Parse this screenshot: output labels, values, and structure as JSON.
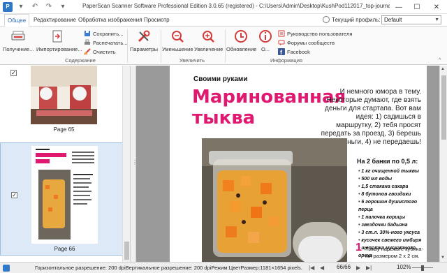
{
  "window": {
    "title": "PaperScan Scanner Software Professional Edition 3.0.65 (registered) - C:\\Users\\Admin\\Desktop\\KushPod112017_top-journals.pdf Page(66)"
  },
  "tabs": [
    {
      "label": "Общее"
    },
    {
      "label": "Редактирование"
    },
    {
      "label": "Обработка изображения"
    },
    {
      "label": "Просмотр"
    }
  ],
  "profile": {
    "label": "Текущий профиль:",
    "value": "Default"
  },
  "ribbon": {
    "acquire": "Получение...",
    "import": "Импортирование...",
    "save": "Сохранить...",
    "print": "Распечатать...",
    "clear": "Очистить",
    "params": "Параметры",
    "zoom_out": "Уменьшение",
    "zoom_in": "Увеличение",
    "update": "Обновление",
    "about": "О...",
    "user_guide": "Руководство пользователя",
    "forums": "Форумы сообществ",
    "facebook": "Facebook",
    "group_content": "Содержание",
    "group_zoom": "Увеличить",
    "group_info": "Информация"
  },
  "thumbnails": [
    {
      "label": "Page 65"
    },
    {
      "label": "Page 66"
    }
  ],
  "page": {
    "section": "Своими руками",
    "heading_line1": "Маринованная",
    "heading_line2": "тыква",
    "intro": "И немного юмора в тему. Некоторые думают, где взять деньги для стартапа. Вот вам идея: 1) садишься в маршрутку, 2) тебя просят передать за проезд, 3) берешь деньги, 4) не передаешь!",
    "ingredients_title": "На 2 банки по 0,5 л:",
    "ingredients": [
      "1 кг очищенной тыквы",
      "500 мл воды",
      "1,5 стакана сахара",
      "8 бутонов гвоздики",
      "6 горошин душистого перца",
      "1 палочка корицы",
      "звездочки бадьяна",
      "3 ст.л. 30%-ного уксуса",
      "кусочек свежего имбиря",
      "щепотка мускатного ореха"
    ],
    "step_num": "1",
    "step_text": "Тыкву нарежьте кубика-ми размером 2 х 2 см."
  },
  "status": {
    "text": "Горизонтальное разрешение: 200 dpiВертикальное разрешение: 200 dpiРежим:ЦветРазмер:1181×1654 pixels.",
    "page": "66/66",
    "zoom": "102%"
  },
  "colors": {
    "accent": "#2f78c4",
    "heading": "#e0186f",
    "selection": "#dde9f7"
  }
}
